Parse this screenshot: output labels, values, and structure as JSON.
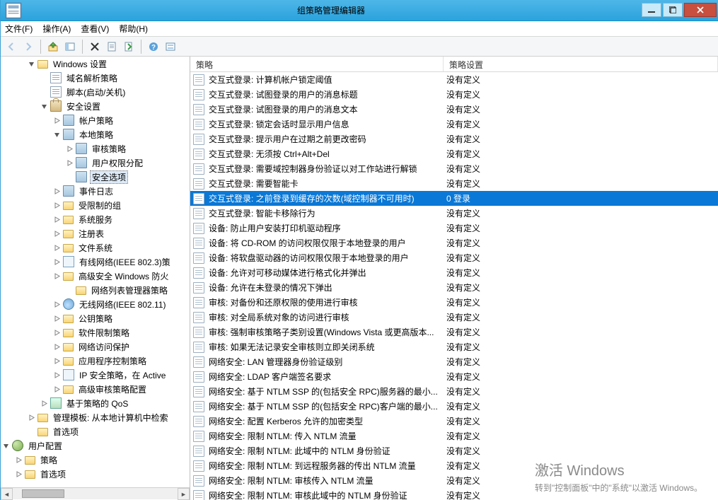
{
  "window": {
    "title": "组策略管理编辑器"
  },
  "menubar": {
    "file": "文件(F)",
    "action": "操作(A)",
    "view": "查看(V)",
    "help": "帮助(H)"
  },
  "list": {
    "col_policy": "策略",
    "col_setting": "策略设置"
  },
  "watermark": {
    "l1": "激活 Windows",
    "l2": "转到\"控制面板\"中的\"系统\"以激活 Windows。"
  },
  "tree": [
    {
      "d": 2,
      "exp": "open",
      "ic": "i-folder",
      "t": "Windows 设置"
    },
    {
      "d": 3,
      "exp": "none",
      "ic": "i-page",
      "t": "域名解析策略"
    },
    {
      "d": 3,
      "exp": "none",
      "ic": "i-page",
      "t": "脚本(启动/关机)"
    },
    {
      "d": 3,
      "exp": "open",
      "ic": "i-lock",
      "t": "安全设置"
    },
    {
      "d": 4,
      "exp": "closed",
      "ic": "i-book",
      "t": "帐户策略"
    },
    {
      "d": 4,
      "exp": "open",
      "ic": "i-book",
      "t": "本地策略"
    },
    {
      "d": 5,
      "exp": "closed",
      "ic": "i-book",
      "t": "审核策略"
    },
    {
      "d": 5,
      "exp": "closed",
      "ic": "i-book",
      "t": "用户权限分配"
    },
    {
      "d": 5,
      "exp": "none",
      "ic": "i-book",
      "t": "安全选项",
      "sel": true
    },
    {
      "d": 4,
      "exp": "closed",
      "ic": "i-book",
      "t": "事件日志"
    },
    {
      "d": 4,
      "exp": "closed",
      "ic": "i-folder",
      "t": "受限制的组"
    },
    {
      "d": 4,
      "exp": "closed",
      "ic": "i-folder",
      "t": "系统服务"
    },
    {
      "d": 4,
      "exp": "closed",
      "ic": "i-folder",
      "t": "注册表"
    },
    {
      "d": 4,
      "exp": "closed",
      "ic": "i-folder",
      "t": "文件系统"
    },
    {
      "d": 4,
      "exp": "closed",
      "ic": "i-net",
      "t": "有线网络(IEEE 802.3)策"
    },
    {
      "d": 4,
      "exp": "closed",
      "ic": "i-folder",
      "t": "高级安全 Windows 防火"
    },
    {
      "d": 5,
      "exp": "none",
      "ic": "i-folder",
      "t": "网络列表管理器策略"
    },
    {
      "d": 4,
      "exp": "closed",
      "ic": "i-wifi",
      "t": "无线网络(IEEE 802.11)"
    },
    {
      "d": 4,
      "exp": "closed",
      "ic": "i-folder",
      "t": "公钥策略"
    },
    {
      "d": 4,
      "exp": "closed",
      "ic": "i-folder",
      "t": "软件限制策略"
    },
    {
      "d": 4,
      "exp": "closed",
      "ic": "i-folder",
      "t": "网络访问保护"
    },
    {
      "d": 4,
      "exp": "closed",
      "ic": "i-folder",
      "t": "应用程序控制策略"
    },
    {
      "d": 4,
      "exp": "closed",
      "ic": "i-net",
      "t": "IP 安全策略，在 Active"
    },
    {
      "d": 4,
      "exp": "closed",
      "ic": "i-folder",
      "t": "高级审核策略配置"
    },
    {
      "d": 3,
      "exp": "closed",
      "ic": "i-chip",
      "t": "基于策略的 QoS"
    },
    {
      "d": 2,
      "exp": "closed",
      "ic": "i-folder",
      "t": "管理模板: 从本地计算机中检索"
    },
    {
      "d": 2,
      "exp": "none",
      "ic": "i-folder",
      "t": "首选项"
    },
    {
      "d": 0,
      "exp": "open",
      "ic": "i-users",
      "t": "用户配置"
    },
    {
      "d": 1,
      "exp": "closed",
      "ic": "i-folder",
      "t": "策略"
    },
    {
      "d": 1,
      "exp": "closed",
      "ic": "i-folder",
      "t": "首选项"
    }
  ],
  "policies": [
    {
      "n": "交互式登录: 计算机帐户锁定阈值",
      "v": "没有定义"
    },
    {
      "n": "交互式登录: 试图登录的用户的消息标题",
      "v": "没有定义"
    },
    {
      "n": "交互式登录: 试图登录的用户的消息文本",
      "v": "没有定义"
    },
    {
      "n": "交互式登录: 锁定会话时显示用户信息",
      "v": "没有定义"
    },
    {
      "n": "交互式登录: 提示用户在过期之前更改密码",
      "v": "没有定义"
    },
    {
      "n": "交互式登录: 无须按 Ctrl+Alt+Del",
      "v": "没有定义"
    },
    {
      "n": "交互式登录: 需要域控制器身份验证以对工作站进行解锁",
      "v": "没有定义"
    },
    {
      "n": "交互式登录: 需要智能卡",
      "v": "没有定义"
    },
    {
      "n": "交互式登录: 之前登录到缓存的次数(域控制器不可用时)",
      "v": "0 登录",
      "sel": true
    },
    {
      "n": "交互式登录: 智能卡移除行为",
      "v": "没有定义"
    },
    {
      "n": "设备: 防止用户安装打印机驱动程序",
      "v": "没有定义"
    },
    {
      "n": "设备: 将 CD-ROM 的访问权限仅限于本地登录的用户",
      "v": "没有定义"
    },
    {
      "n": "设备: 将软盘驱动器的访问权限仅限于本地登录的用户",
      "v": "没有定义"
    },
    {
      "n": "设备: 允许对可移动媒体进行格式化并弹出",
      "v": "没有定义"
    },
    {
      "n": "设备: 允许在未登录的情况下弹出",
      "v": "没有定义"
    },
    {
      "n": "审核: 对备份和还原权限的使用进行审核",
      "v": "没有定义"
    },
    {
      "n": "审核: 对全局系统对象的访问进行审核",
      "v": "没有定义"
    },
    {
      "n": "审核: 强制审核策略子类别设置(Windows Vista 或更高版本...",
      "v": "没有定义"
    },
    {
      "n": "审核: 如果无法记录安全审核则立即关闭系统",
      "v": "没有定义"
    },
    {
      "n": "网络安全: LAN 管理器身份验证级别",
      "v": "没有定义"
    },
    {
      "n": "网络安全: LDAP 客户端签名要求",
      "v": "没有定义"
    },
    {
      "n": "网络安全: 基于 NTLM SSP 的(包括安全 RPC)服务器的最小...",
      "v": "没有定义"
    },
    {
      "n": "网络安全: 基于 NTLM SSP 的(包括安全 RPC)客户端的最小...",
      "v": "没有定义"
    },
    {
      "n": "网络安全: 配置 Kerberos 允许的加密类型",
      "v": "没有定义"
    },
    {
      "n": "网络安全: 限制 NTLM: 传入 NTLM 流量",
      "v": "没有定义"
    },
    {
      "n": "网络安全: 限制 NTLM: 此域中的 NTLM 身份验证",
      "v": "没有定义"
    },
    {
      "n": "网络安全: 限制 NTLM: 到远程服务器的传出 NTLM 流量",
      "v": "没有定义"
    },
    {
      "n": "网络安全: 限制 NTLM: 审核传入 NTLM 流量",
      "v": "没有定义"
    },
    {
      "n": "网络安全: 限制 NTLM: 审核此域中的 NTLM 身份验证",
      "v": "没有定义"
    }
  ]
}
